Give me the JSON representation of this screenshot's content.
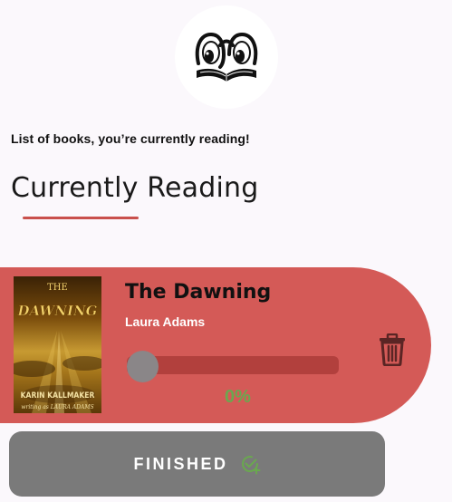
{
  "app": {
    "logo_icon": "book-eyes-logo-icon",
    "subtitle": "List of books, you’re currently reading!",
    "heading": "Currently Reading"
  },
  "book": {
    "title": "The Dawning",
    "author": "Laura Adams",
    "progress_percent": 0,
    "progress_text": "0%",
    "cover": {
      "top_text": "THE",
      "title_text": "DAWNING",
      "author_text": "KARIN KALLMAKER",
      "byline_text": "writing as LAURA ADAMS"
    },
    "delete_icon": "trash-icon"
  },
  "actions": {
    "finished_label": "FINISHED",
    "finished_icon": "check-add-icon"
  },
  "colors": {
    "card": "#d45a57",
    "underline": "#c9504c",
    "progress_text": "#6aa84f",
    "button": "#7a7a7a",
    "background": "#fbf8fc"
  }
}
